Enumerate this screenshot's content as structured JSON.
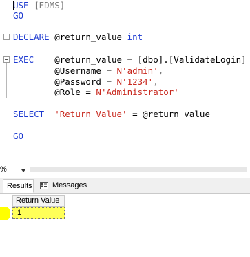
{
  "editor": {
    "lines": {
      "use_kw": "USE",
      "use_db": " [EDMS]",
      "go1": "GO",
      "declare_kw": "DECLARE",
      "declare_var": " @return_value ",
      "declare_type": "int",
      "exec_kw": "EXEC",
      "exec_assign": "    @return_value = [dbo].[ValidateLogin]",
      "p1_name": "        @Username = ",
      "p1_val": "N'admin'",
      "p1_comma": ",",
      "p2_name": "        @Password = ",
      "p2_val": "N'1234'",
      "p2_comma": ",",
      "p3_name": "        @Role = ",
      "p3_val": "N'Administrator'",
      "select_kw": "SELECT",
      "select_alias": "'Return Value'",
      "select_rest": " = @return_value",
      "go2": "GO"
    }
  },
  "zoom": {
    "value": "%"
  },
  "tabs": {
    "results": "Results",
    "messages": "Messages"
  },
  "grid": {
    "columns": [
      "Return Value"
    ],
    "rows": [
      [
        "1"
      ]
    ]
  },
  "colors": {
    "keyword": "#1d3ad0",
    "string": "#c8281e",
    "highlight": "#ffff58"
  }
}
